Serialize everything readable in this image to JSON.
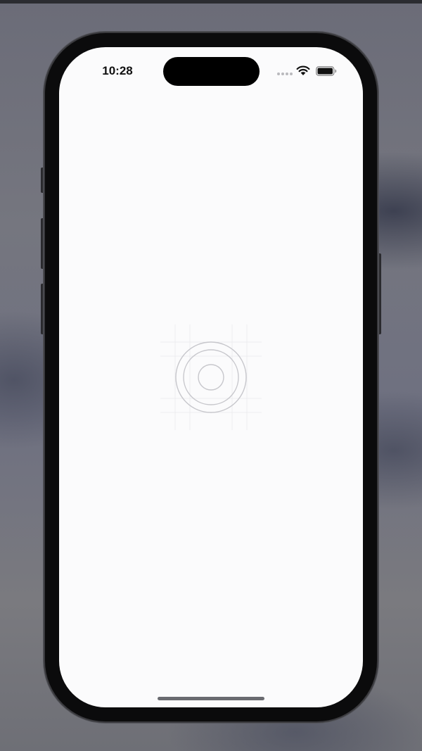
{
  "status_bar": {
    "time": "10:28",
    "icons": [
      "signal-dots-icon",
      "wifi-icon",
      "battery-icon"
    ]
  },
  "screen": {
    "background": "#fbfbfc",
    "placeholder_icon": "concentric-circles-grid-icon"
  },
  "colors": {
    "frame": "#0b0b0c",
    "icon_stroke": "#c7c7cc",
    "grid": "#ececef"
  }
}
